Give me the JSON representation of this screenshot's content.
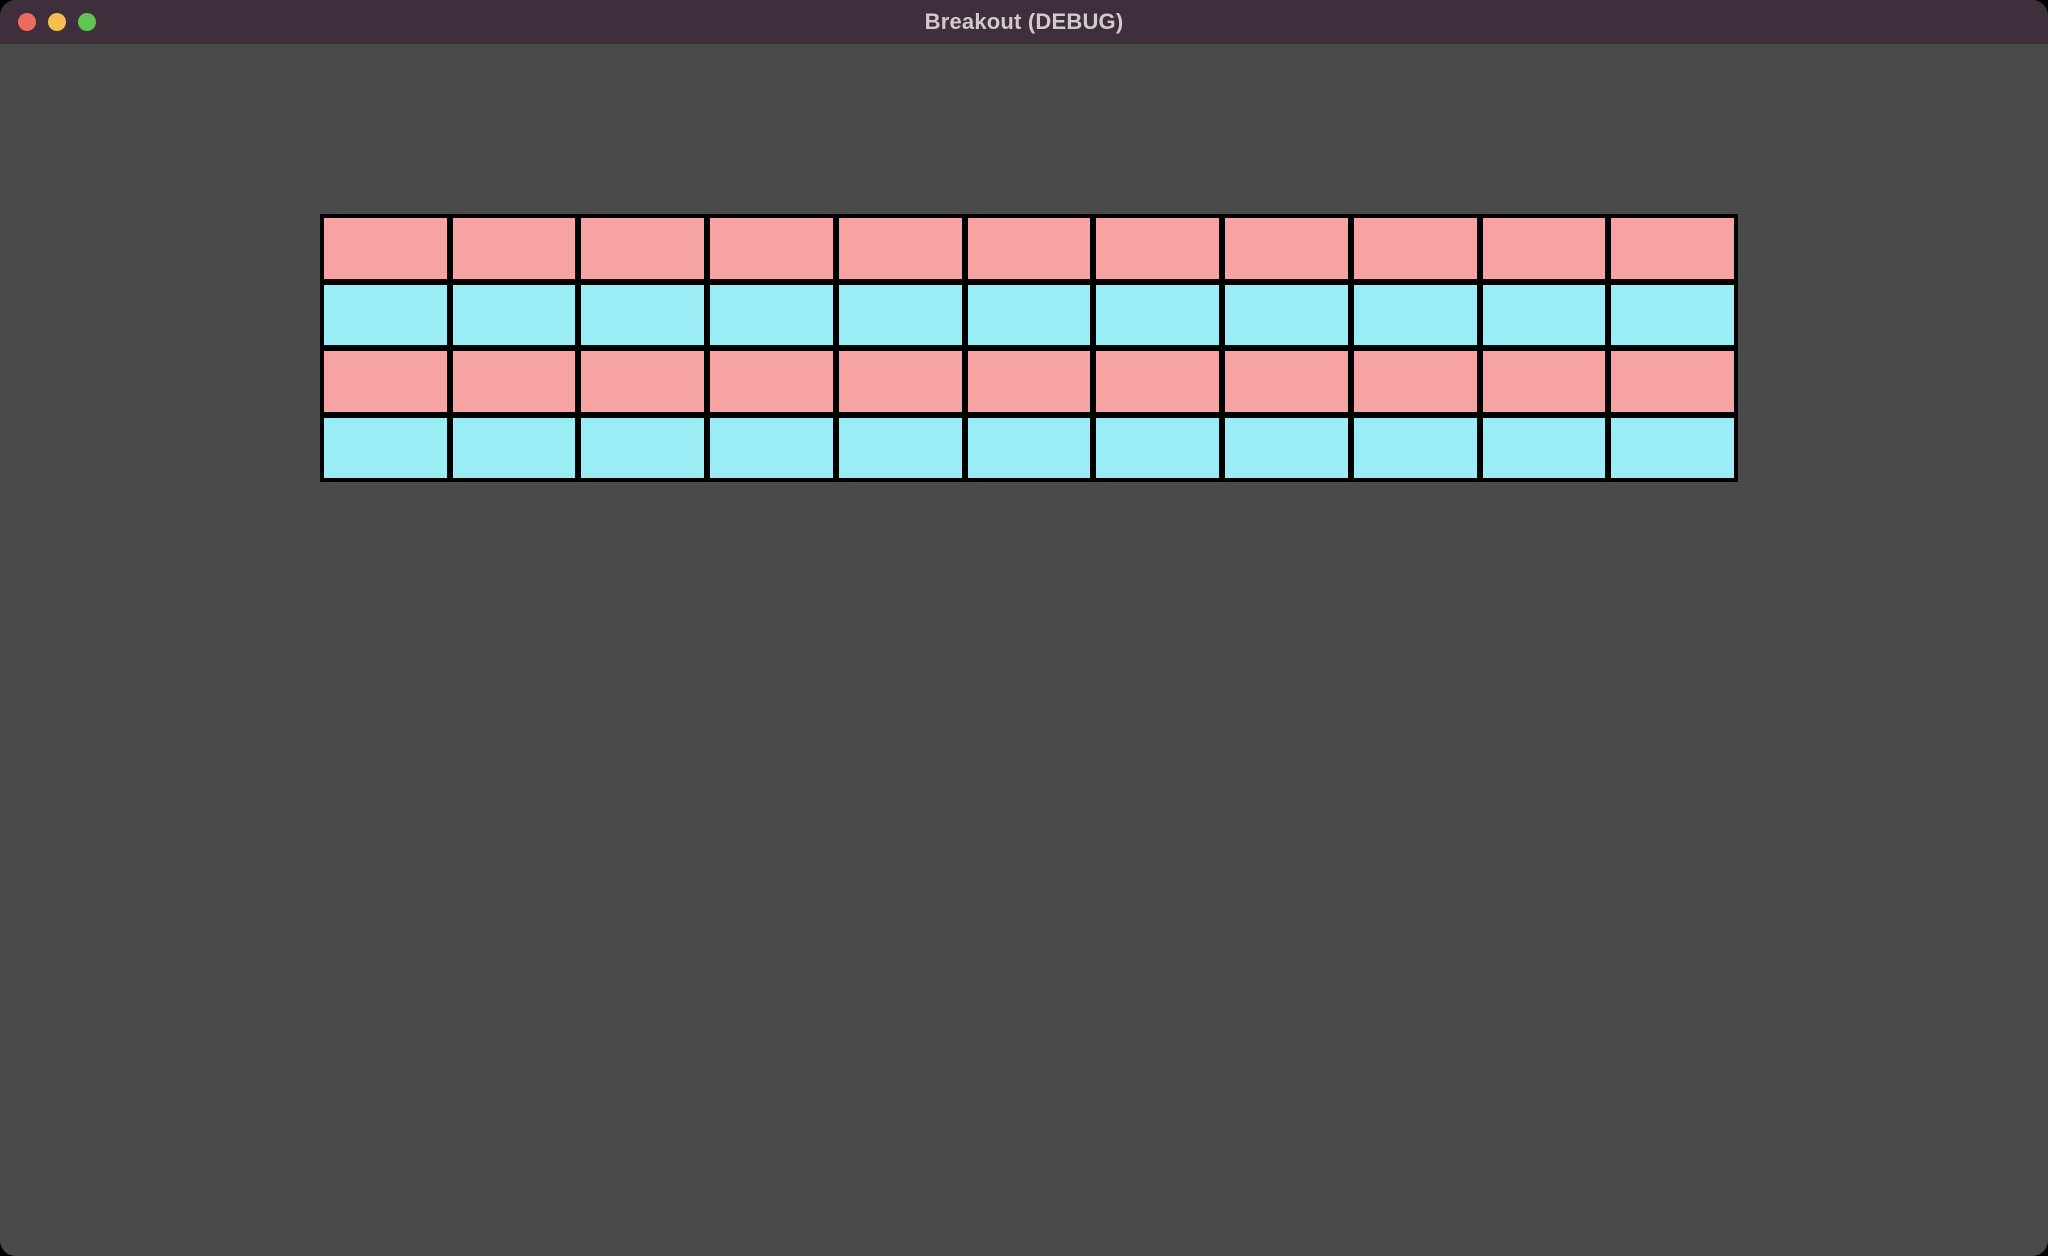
{
  "window": {
    "title": "Breakout (DEBUG)"
  },
  "colors": {
    "titlebar": "#3f2e3b",
    "canvas_bg": "#4a4a4a",
    "brick_border": "#000000",
    "brick_pink": "#f7a3a3",
    "brick_cyan": "#9aecf5",
    "traffic_red": "#ed6a5e",
    "traffic_yellow": "#f5bf4f",
    "traffic_green": "#61c554"
  },
  "game": {
    "brick_grid": {
      "cols": 11,
      "rows": 4,
      "row_colors": [
        "pink",
        "cyan",
        "pink",
        "cyan"
      ]
    }
  }
}
